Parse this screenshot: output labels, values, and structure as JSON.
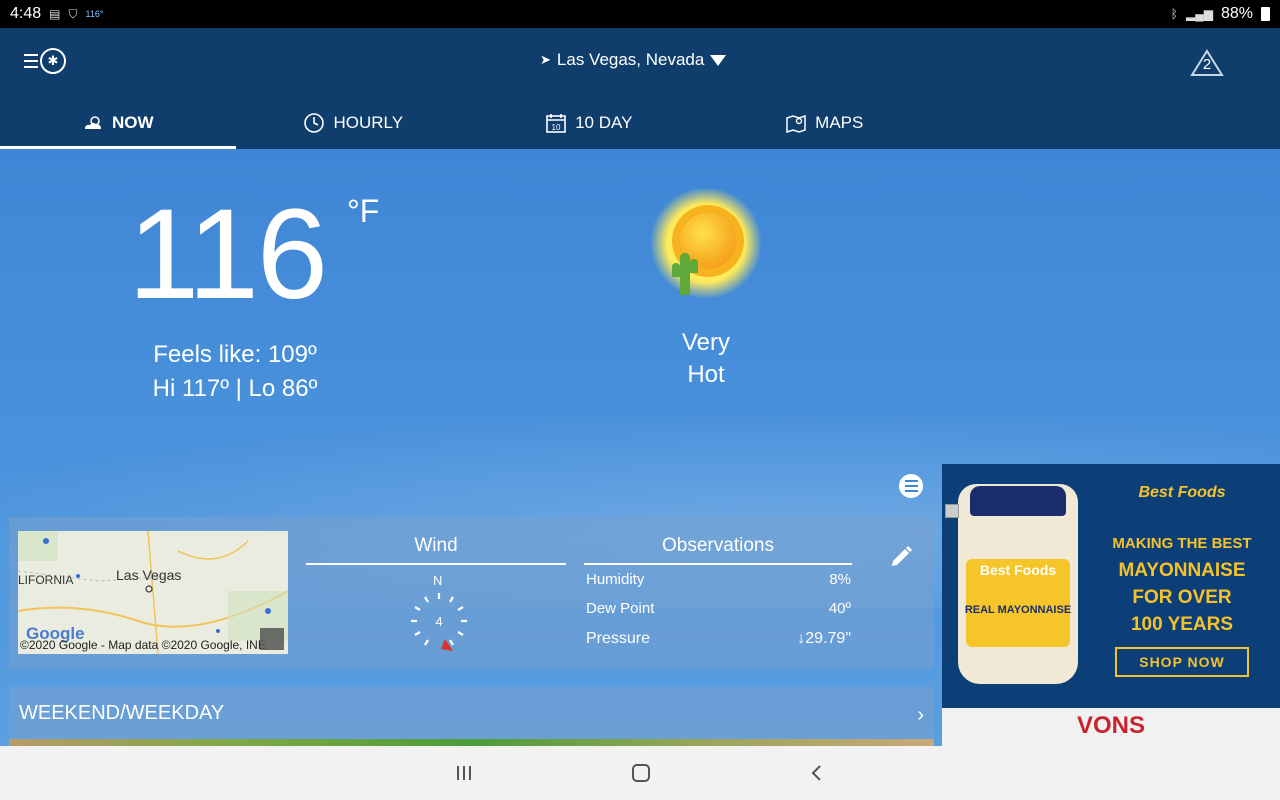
{
  "status_bar": {
    "time": "4:48",
    "temp_icon_text": "116°",
    "battery": "88%"
  },
  "header": {
    "location": "Las Vegas, Nevada",
    "alert_count": "2"
  },
  "tabs": [
    {
      "label": "NOW",
      "icon": "partly-cloudy-icon",
      "active": true
    },
    {
      "label": "HOURLY",
      "icon": "clock-icon"
    },
    {
      "label": "10 DAY",
      "icon": "calendar-icon"
    },
    {
      "label": "MAPS",
      "icon": "map-icon"
    }
  ],
  "calendar_day": "10",
  "current": {
    "temperature": "116",
    "unit": "°F",
    "feels_like": "Feels like: 109º",
    "hi_lo": "Hi 117º | Lo 86º",
    "condition_line1": "Very",
    "condition_line2": "Hot",
    "condition_icon": "sun-cactus-icon"
  },
  "map": {
    "city_label": "Las Vegas",
    "region_label": "LIFORNIA",
    "copyright": "©2020 Google - Map data ©2020 Google, INE",
    "google_logo": "Google"
  },
  "wind": {
    "title": "Wind",
    "direction_label": "N",
    "speed": "4"
  },
  "observations": {
    "title": "Observations",
    "rows": [
      {
        "label": "Humidity",
        "value": "8%"
      },
      {
        "label": "Dew Point",
        "value": "40º"
      },
      {
        "label": "Pressure",
        "value": "↓29.79\""
      }
    ]
  },
  "weekend": {
    "label": "WEEKEND/WEEKDAY"
  },
  "ad": {
    "jar_brand": "Best Foods",
    "jar_sub": "REAL MAYONNAISE",
    "brand": "Best Foods",
    "headline_1": "MAKING THE BEST",
    "headline_2": "MAYONNAISE",
    "headline_3": "FOR OVER",
    "headline_4": "100 YEARS",
    "cta": "SHOP NOW",
    "store": "VONS"
  },
  "colors": {
    "header_bg": "#0f3e6d",
    "sky": "#4b93dc",
    "ad_bg": "#0c3f78",
    "ad_accent": "#f5c22a"
  }
}
